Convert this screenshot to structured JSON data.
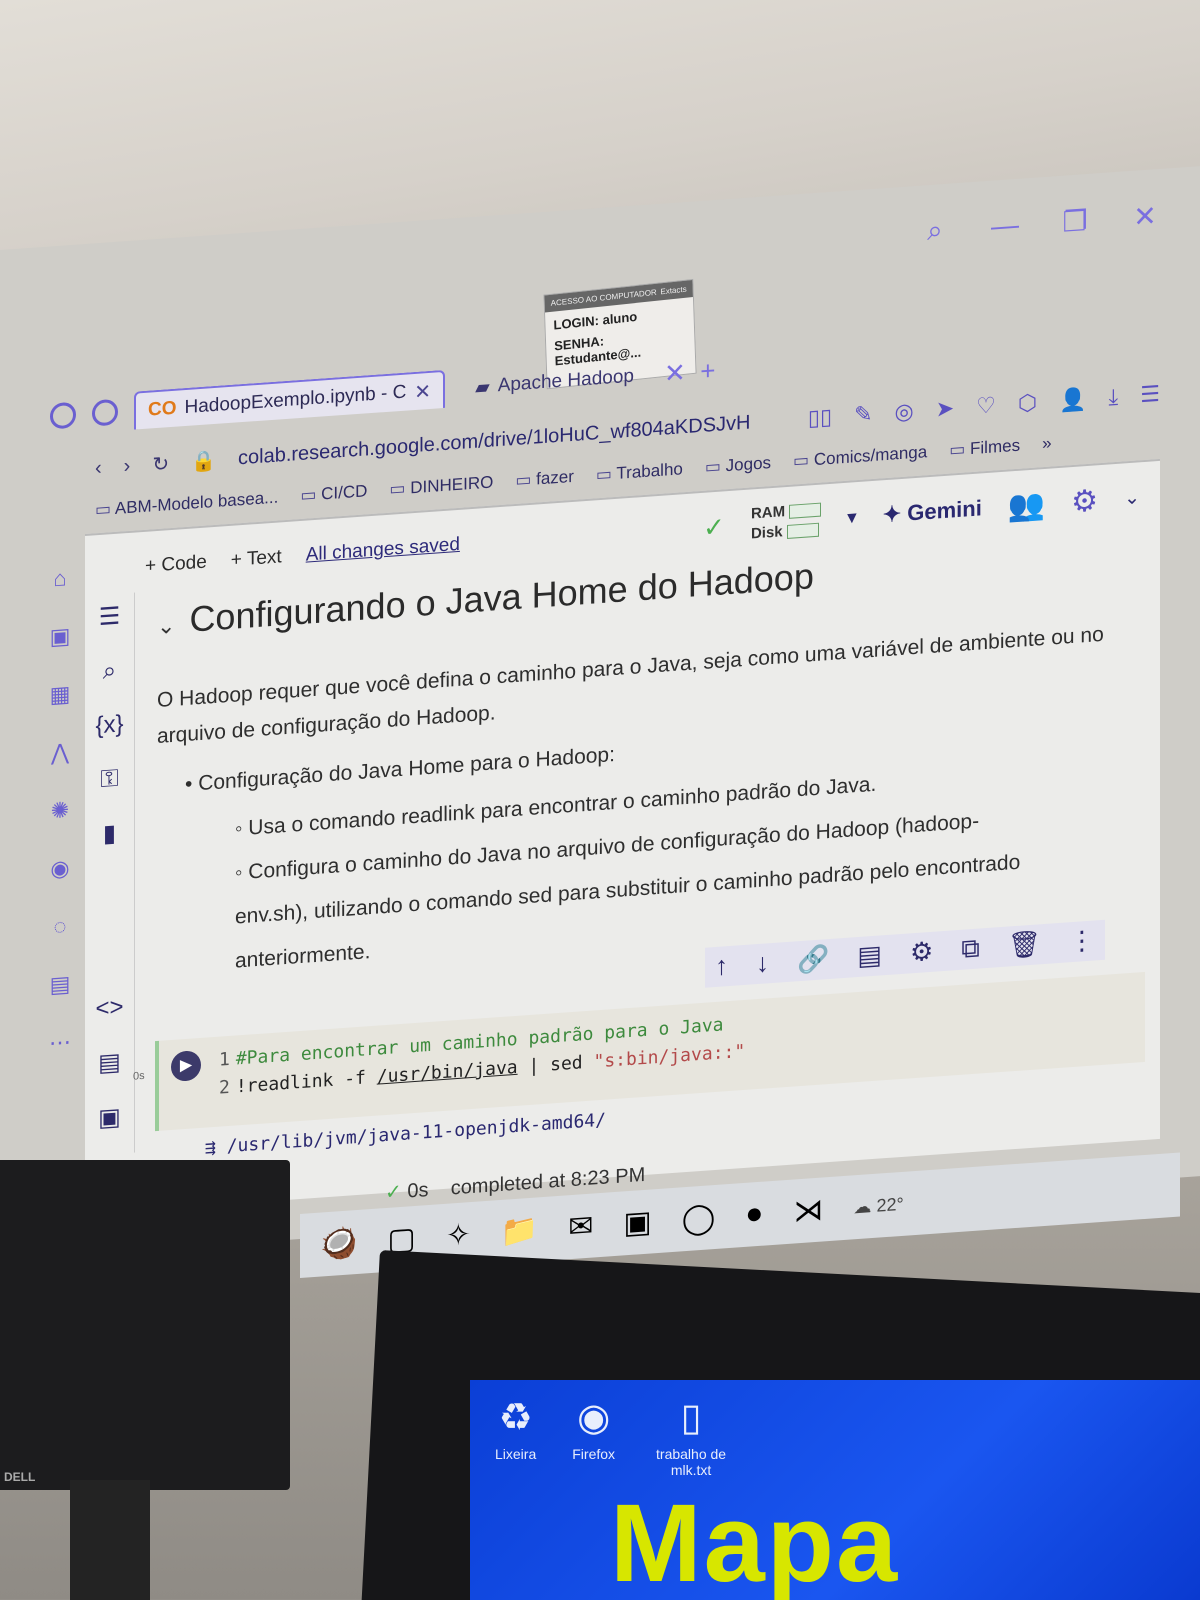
{
  "browser": {
    "tabs": [
      {
        "label": "HadoopExemplo.ipynb - C",
        "active": true
      },
      {
        "label": "Apache Hadoop",
        "active": false
      }
    ],
    "url": "colab.research.google.com/drive/1loHuC_wf804aKDSJvH",
    "bookmarks": [
      "ABM-Modelo basea...",
      "CI/CD",
      "DINHEIRO",
      "fazer",
      "Trabalho",
      "Jogos",
      "Comics/manga",
      "Filmes"
    ]
  },
  "sticky_note": {
    "header_left": "ACESSO AO COMPUTADOR",
    "header_right": "Extacts",
    "login": "LOGIN: aluno",
    "senha": "SENHA: Estudante@..."
  },
  "colab": {
    "toolbar": {
      "code": "+ Code",
      "text": "+ Text",
      "saved": "All changes saved",
      "ram": "RAM",
      "disk": "Disk",
      "gemini": "Gemini"
    },
    "heading": "Configurando o Java Home do Hadoop",
    "paragraph": "O Hadoop requer que você defina o caminho para o Java, seja como uma variável de ambiente ou no arquivo de configuração do Hadoop.",
    "bullet": "Configuração do Java Home para o Hadoop:",
    "sub_bullets": [
      "Usa o comando readlink para encontrar o caminho padrão do Java.",
      "Configura o caminho do Java no arquivo de configuração do Hadoop (hadoop-env.sh), utilizando o comando sed para substituir o caminho padrão pelo encontrado anteriormente."
    ],
    "code": {
      "line1_num": "1",
      "line1": "#Para encontrar um caminho padrão para o Java",
      "line2_num": "2",
      "line2_cmd": "!readlink -f ",
      "line2_path": "/usr/bin/java",
      "line2_pipe": " | sed ",
      "line2_str": "\"s:bin/java::\"",
      "exec_time": "0s"
    },
    "output": "/usr/lib/jvm/java-11-openjdk-amd64/",
    "status": {
      "time": "0s",
      "completed": "completed at 8:23 PM"
    }
  },
  "taskbar": {
    "weather": "22°"
  },
  "desktop": {
    "icons": [
      "Lixeira",
      "Firefox",
      "trabalho de mlk.txt"
    ],
    "wallpaper_text": "Mapa"
  },
  "monitor_brand": "DELL",
  "colors": {
    "accent": "#6a5fd0",
    "colab_orange": "#e07a1a",
    "ok_green": "#4caf50",
    "desktop_blue": "#1a56f0"
  }
}
